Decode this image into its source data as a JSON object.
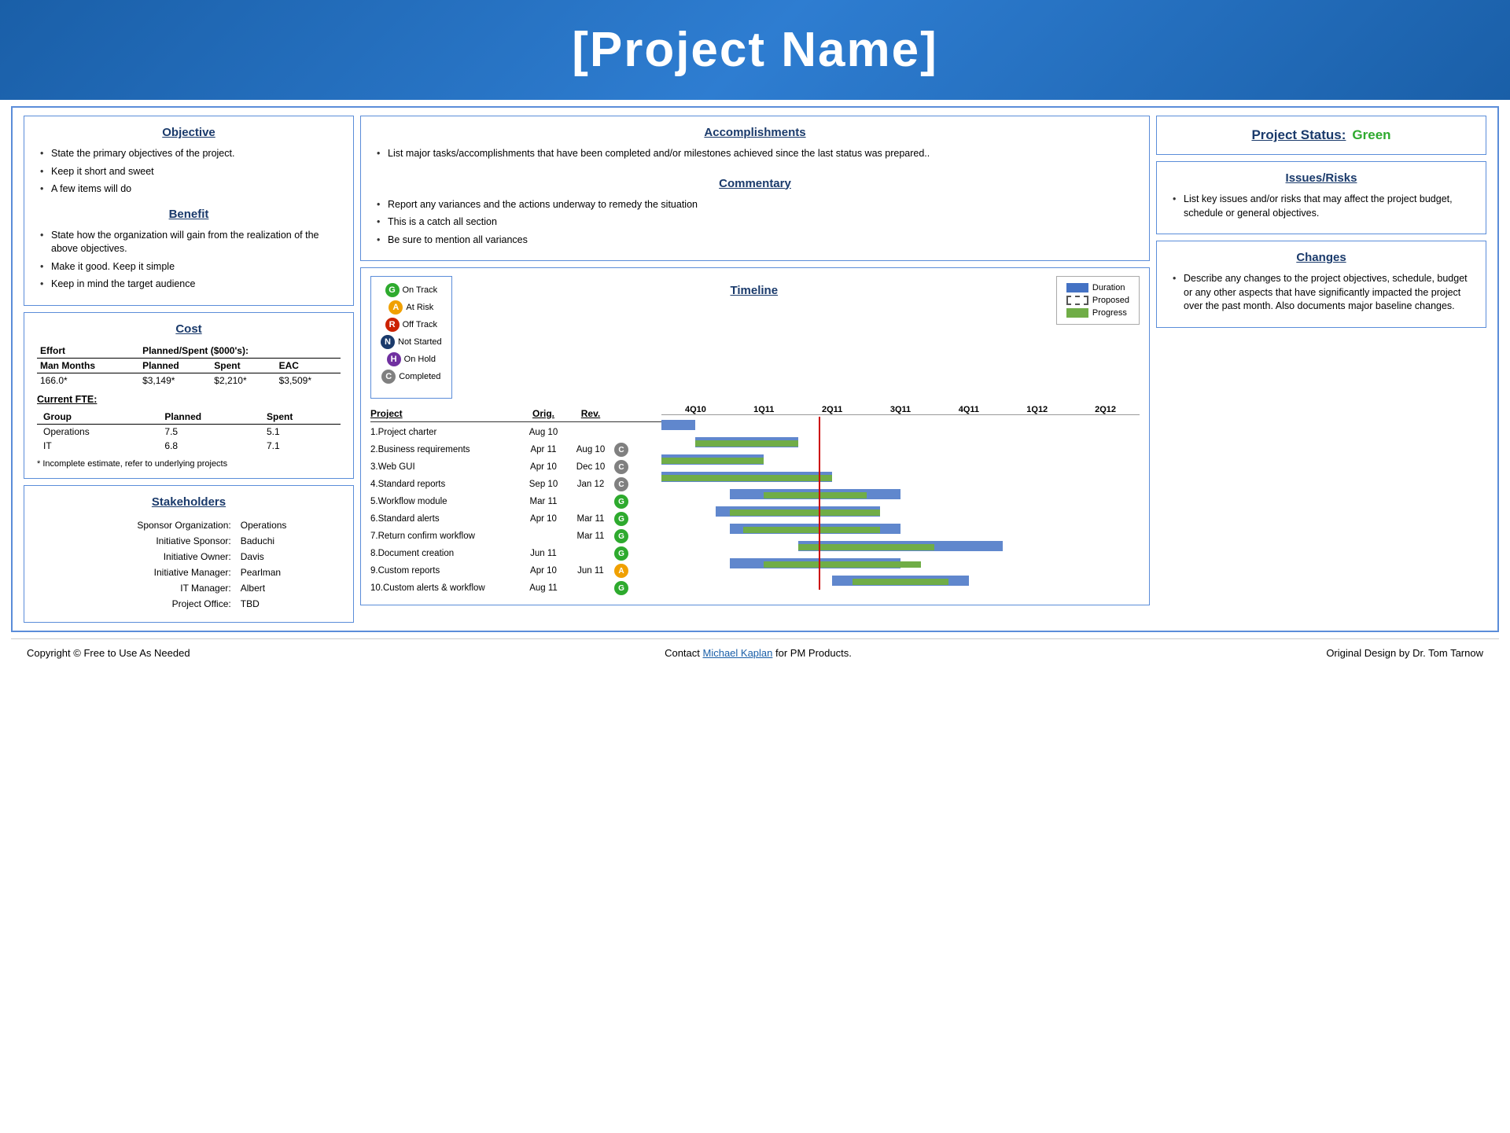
{
  "header": {
    "title": "[Project Name]"
  },
  "objective": {
    "title": "Objective",
    "items": [
      "State the primary objectives of the project.",
      "Keep it short and sweet",
      "A few items will do"
    ]
  },
  "benefit": {
    "title": "Benefit",
    "items": [
      "State how the organization will gain from the realization of the above objectives.",
      "Make it good. Keep it simple",
      "Keep in mind the target audience"
    ]
  },
  "cost": {
    "title": "Cost",
    "effort_label": "Effort",
    "planned_spent_label": "Planned/Spent ($000's):",
    "cols": [
      "Man Months",
      "Planned",
      "Spent",
      "EAC"
    ],
    "values": [
      "166.0*",
      "$3,149*",
      "$2,210*",
      "$3,509*"
    ],
    "fte_label": "Current FTE:",
    "fte_cols": [
      "Group",
      "Planned",
      "Spent"
    ],
    "fte_rows": [
      [
        "Operations",
        "7.5",
        "5.1"
      ],
      [
        "IT",
        "6.8",
        "7.1"
      ]
    ],
    "footnote": "* Incomplete estimate, refer to underlying projects"
  },
  "stakeholders": {
    "title": "Stakeholders",
    "rows": [
      [
        "Sponsor Organization:",
        "Operations"
      ],
      [
        "Initiative Sponsor:",
        "Baduchi"
      ],
      [
        "Initiative Owner:",
        "Davis"
      ],
      [
        "Initiative Manager:",
        "Pearlman"
      ],
      [
        "IT Manager:",
        "Albert"
      ],
      [
        "Project Office:",
        "TBD"
      ]
    ]
  },
  "accomplishments": {
    "title": "Accomplishments",
    "items": [
      "List major tasks/accomplishments that have been completed and/or milestones achieved since the last status was prepared.."
    ]
  },
  "commentary": {
    "title": "Commentary",
    "items": [
      "Report any variances and the actions underway to remedy the situation",
      "This is a catch all section",
      "Be sure to mention all variances"
    ]
  },
  "project_status": {
    "label": "Project Status:",
    "value": "Green"
  },
  "issues_risks": {
    "title": "Issues/Risks",
    "items": [
      "List key issues and/or risks that may affect the project budget, schedule or general objectives."
    ]
  },
  "changes": {
    "title": "Changes",
    "items": [
      "Describe any changes to the project objectives, schedule, budget or any other aspects that have significantly impacted the project over the past month. Also documents major baseline changes."
    ]
  },
  "legend": {
    "items": [
      {
        "symbol": "G",
        "color": "lg-green",
        "label": "On Track"
      },
      {
        "symbol": "A",
        "color": "lg-orange",
        "label": "At Risk"
      },
      {
        "symbol": "R",
        "color": "lg-red",
        "label": "Off Track"
      },
      {
        "symbol": "N",
        "color": "lg-navy",
        "label": "Not Started"
      },
      {
        "symbol": "H",
        "color": "lg-purple",
        "label": "On Hold"
      },
      {
        "symbol": "C",
        "color": "lg-gray",
        "label": "Completed"
      }
    ]
  },
  "timeline": {
    "title": "Timeline",
    "legend": [
      {
        "label": "Duration",
        "type": "duration"
      },
      {
        "label": "Proposed",
        "type": "proposed"
      },
      {
        "label": "Progress",
        "type": "progress"
      }
    ],
    "col_headers": [
      "4Q10",
      "1Q11",
      "2Q11",
      "3Q11",
      "4Q11",
      "1Q12",
      "2Q12"
    ],
    "projects": [
      {
        "name": "Project",
        "orig": "Orig.",
        "rev": "Rev.",
        "status": "",
        "header": true
      },
      {
        "name": "1.Project charter",
        "orig": "Aug 10",
        "rev": "",
        "status": ""
      },
      {
        "name": "2.Business requirements",
        "orig": "Apr 11",
        "rev": "Aug 10",
        "status": "C"
      },
      {
        "name": "3.Web GUI",
        "orig": "Apr 10",
        "rev": "Dec 10",
        "status": "C"
      },
      {
        "name": "4.Standard reports",
        "orig": "Sep 10",
        "rev": "Jan 12",
        "status": "C"
      },
      {
        "name": "5.Workflow module",
        "orig": "Mar 11",
        "rev": "",
        "status": "G"
      },
      {
        "name": "6.Standard alerts",
        "orig": "Apr 10",
        "rev": "Mar 11",
        "status": "G"
      },
      {
        "name": "7.Return confirm workflow",
        "orig": "",
        "rev": "Mar 11",
        "status": "G"
      },
      {
        "name": "8.Document creation",
        "orig": "Jun 11",
        "rev": "",
        "status": "G"
      },
      {
        "name": "9.Custom reports",
        "orig": "Apr 10",
        "rev": "Jun 11",
        "status": "A"
      },
      {
        "name": "10.Custom alerts & workflow",
        "orig": "Aug 11",
        "rev": "",
        "status": "G"
      }
    ]
  },
  "footer": {
    "left": "Copyright © Free to Use As Needed",
    "center_pre": "Contact ",
    "center_link": "Michael Kaplan",
    "center_post": " for PM Products.",
    "right": "Original Design by Dr. Tom Tarnow"
  }
}
